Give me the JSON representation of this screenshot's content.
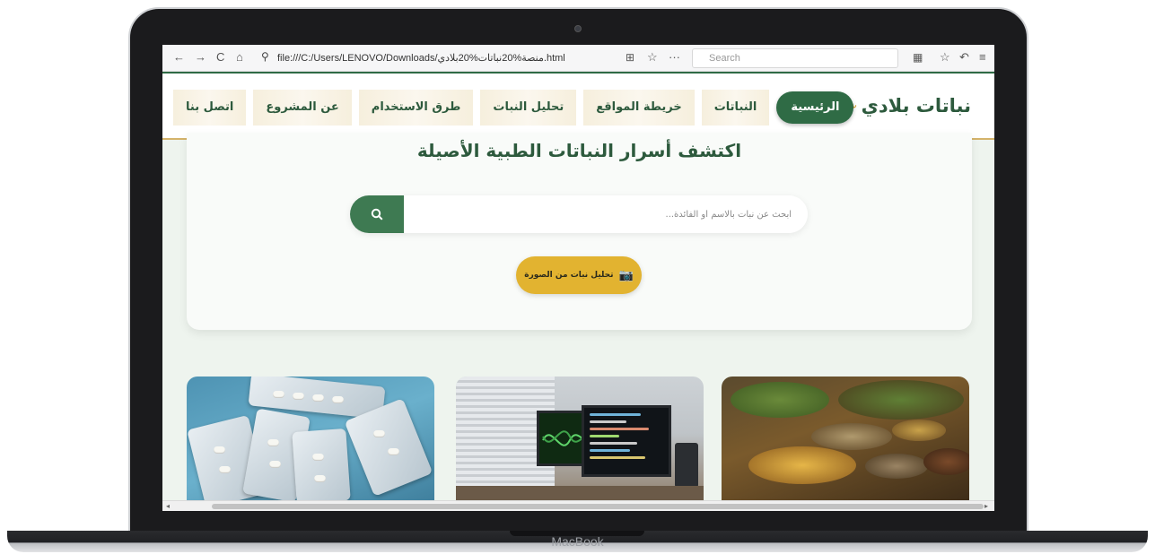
{
  "device": {
    "label": "MacBook"
  },
  "browser": {
    "url": "file:///C:/Users/LENOVO/Downloads/منصة%20نباتات%20بلادي.html",
    "search_placeholder": "Search",
    "nav_icons": [
      "back-icon",
      "forward-icon",
      "reload-icon",
      "home-icon"
    ],
    "right_icons": [
      "translate-icon",
      "star-icon",
      "more-icon",
      "extensions-icon",
      "bookmarks-icon",
      "undo-icon",
      "menu-icon"
    ]
  },
  "site": {
    "brand": "نباتات بلادي",
    "nav": [
      {
        "label": "الرئيسية",
        "active": true
      },
      {
        "label": "النباتات",
        "active": false
      },
      {
        "label": "خريطة المواقع",
        "active": false
      },
      {
        "label": "تحليل النبات",
        "active": false
      },
      {
        "label": "طرق الاستخدام",
        "active": false
      },
      {
        "label": "عن المشروع",
        "active": false
      },
      {
        "label": "اتصل بنا",
        "active": false
      }
    ],
    "hero": {
      "title": "اكتشف أسرار النباتات الطبية الأصيلة",
      "search_placeholder": "ابحث عن نبات بالاسم أو الفائدة...",
      "analyze_label": "تحليل نبات من الصورة"
    }
  },
  "colors": {
    "primary_green": "#2f6b45",
    "accent_gold": "#e2b330",
    "page_bg": "#eef4ee"
  }
}
